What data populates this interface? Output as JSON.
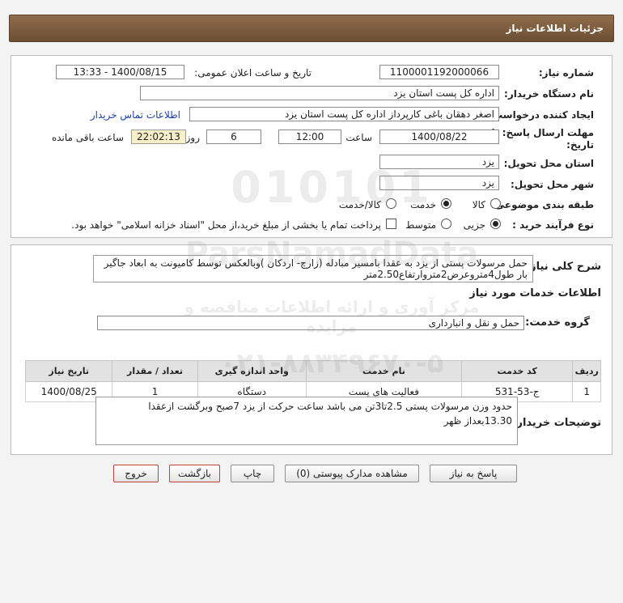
{
  "header": {
    "title": "جزئیات اطلاعات نیاز"
  },
  "form": {
    "need_number_label": "شماره نیاز:",
    "need_number": "1100001192000066",
    "announce_label": "تاریخ و ساعت اعلان عمومی:",
    "announce_value": "1400/08/15 - 13:33",
    "buyer_label": "نام دستگاه خریدار:",
    "buyer_value": "اداره کل پست استان یزد",
    "creator_label": "ایجاد کننده درخواست:",
    "creator_value": "اصغر دهقان باغی کارپرداز اداره کل پست استان یزد",
    "contact_link": "اطلاعات تماس خریدار",
    "deadline_label_1": "مهلت ارسال پاسخ: تا",
    "deadline_label_2": "تاریخ:",
    "deadline_date": "1400/08/22",
    "time_label": "ساعت",
    "deadline_time": "12:00",
    "days_value": "6",
    "days_label": "روز و",
    "remaining_time": "22:02:13",
    "remaining_label": "ساعت باقی مانده",
    "province_label": "استان محل تحویل:",
    "province_value": "یزد",
    "city_label": "شهر محل تحویل:",
    "city_value": "یزد",
    "category_label": "طبقه بندی موضوعی:",
    "category_options": [
      "کالا",
      "خدمت",
      "کالا/خدمت"
    ],
    "category_selected": "خدمت",
    "purchase_type_label": "نوع فرآیند خرید :",
    "purchase_options": [
      "جزیی",
      "متوسط"
    ],
    "purchase_selected": "جزیی",
    "payment_note": "پرداخت تمام یا بخشی از مبلغ خرید،از محل \"اسناد خزانه اسلامی\" خواهد بود."
  },
  "general": {
    "label": "شرح کلی نیاز:",
    "description": "حمل مرسولات پستی از یزد به عقدا بامسیر مبادله (زارچ- اردکان )وبالعکس توسط کامیونت به ابعاد جاگیر بار طول4متروعرض2متروارتفاع2.50متر",
    "services_title": "اطلاعات خدمات مورد نیاز",
    "service_group_label": "گروه خدمت:",
    "service_group_value": "حمل و نقل و انبارداری"
  },
  "table": {
    "headers": [
      "ردیف",
      "کد خدمت",
      "نام خدمت",
      "واحد اندازه گیری",
      "تعداد / مقدار",
      "تاریخ نیاز"
    ],
    "rows": [
      [
        "1",
        "ج-53-531",
        "فعالیت های پست",
        "دستگاه",
        "1",
        "1400/08/25"
      ]
    ]
  },
  "buyer_notes": {
    "label": "توضیحات خریدار:",
    "text": "حدود وزن مرسولات پستی 2.5تا3تن می باشد ساعت حرکت از یزد 7صبح وبرگشت ازعقدا 13.30بعداز ظهر"
  },
  "buttons": {
    "reply": "پاسخ به نیاز",
    "attachments": "مشاهده مدارک پیوستی (0)",
    "print": "چاپ",
    "back": "بازگشت",
    "exit": "خروج"
  },
  "watermark": {
    "line1": "010101",
    "line2": "ParsNamadData",
    "line3": "مرکز آوری و ارائه اطلاعات مناقصه و مزایده",
    "line4": "۰۲۱-۸۸۳۴۹۶۷۰-۵"
  },
  "colors": {
    "title_bar": "#7a5a3c",
    "time_highlight": "#f7efc8",
    "link": "#1a3fa8",
    "red_button": "#c34040"
  }
}
